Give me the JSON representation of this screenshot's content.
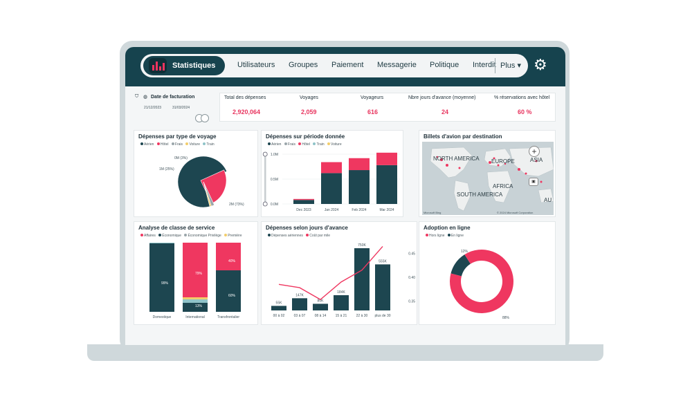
{
  "nav": {
    "active": "Statistiques",
    "items": [
      "Utilisateurs",
      "Groupes",
      "Paiement",
      "Messagerie",
      "Politique",
      "Interdit"
    ],
    "more": "Plus",
    "settings_icon": "gear-icon"
  },
  "filter": {
    "label": "Date de facturation",
    "start": "21/12/2023",
    "end": "31/03/2024"
  },
  "kpis": [
    {
      "label": "Total des dépenses",
      "value": "2,920,064"
    },
    {
      "label": "Voyages",
      "value": "2,059"
    },
    {
      "label": "Voyageurs",
      "value": "616"
    },
    {
      "label": "Nbre jours d'avance (moyenne)",
      "value": "24"
    },
    {
      "label": "% réservations avec hôtel",
      "value": "60 %"
    }
  ],
  "colors": {
    "teal": "#1d4650",
    "pink": "#ef3760",
    "grey": "#9aa6aa",
    "yellow": "#f2cd6a",
    "light": "#8fc3c8"
  },
  "pie_card": {
    "title": "Dépenses par type de voyage",
    "legend": [
      "Aérien",
      "Hôtel",
      "Frais",
      "Voiture",
      "Train"
    ],
    "labels": {
      "small": "0M (3%)",
      "pink": "1M (25%)",
      "teal": "2M (73%)"
    }
  },
  "period_card": {
    "title": "Dépenses sur période donnée",
    "legend": [
      "Aérien",
      "Frais",
      "Hôtel",
      "Train",
      "Voiture"
    ],
    "yticks": [
      "1.0M",
      "0.5M",
      "0.0M"
    ]
  },
  "map_card": {
    "title": "Billets d'avion par destination",
    "labels": [
      "NORTH AMERICA",
      "EUROPE",
      "ASIA",
      "AFRICA",
      "SOUTH AMERICA",
      "AU"
    ],
    "attribution": "© 2024 Microsoft Corporation",
    "brand": "Microsoft Bing"
  },
  "class_card": {
    "title": "Analyse de classe de service",
    "legend": [
      "Affaires",
      "Économique",
      "Économique Privilège",
      "Première"
    ],
    "pct": {
      "dom": "99%",
      "int_pink": "79%",
      "int_teal": "13%",
      "trans_pink": "40%",
      "trans_teal": "60%"
    }
  },
  "advance_card": {
    "title": "Dépenses selon jours d'avance",
    "legend": [
      "Dépenses aériennes",
      "Coût par mile"
    ],
    "yticks_right": [
      "0.45",
      "0.40",
      "0.35"
    ]
  },
  "adoption_card": {
    "title": "Adoption en ligne",
    "legend": [
      "Hors ligne",
      "En ligne"
    ],
    "labels": {
      "offline": "12%",
      "online": "88%"
    }
  },
  "chart_data": [
    {
      "type": "pie",
      "title": "Dépenses par type de voyage",
      "slices": [
        {
          "name": "Aérien",
          "value": 73,
          "label": "2M (73%)"
        },
        {
          "name": "Hôtel",
          "value": 25,
          "label": "1M (25%)"
        },
        {
          "name": "Frais",
          "value": 2,
          "label": "0M (3%)"
        },
        {
          "name": "Voiture",
          "value": 1
        }
      ]
    },
    {
      "type": "bar",
      "title": "Dépenses sur période donnée",
      "categories": [
        "Dec 2023",
        "Jan 2024",
        "Feb 2024",
        "Mar 2024"
      ],
      "series": [
        {
          "name": "Aérien",
          "values": [
            0.08,
            0.62,
            0.68,
            0.78
          ]
        },
        {
          "name": "Hôtel",
          "values": [
            0.02,
            0.22,
            0.24,
            0.25
          ]
        }
      ],
      "ylim": [
        0,
        1.0
      ]
    },
    {
      "type": "bar",
      "title": "Analyse de classe de service",
      "categories": [
        "Domestique",
        "International",
        "Transfrontalier"
      ],
      "series": [
        {
          "name": "Affaires",
          "values": [
            0,
            79,
            40
          ]
        },
        {
          "name": "Économique",
          "values": [
            99,
            13,
            60
          ]
        },
        {
          "name": "Économique Privilège",
          "values": [
            1,
            5,
            0
          ]
        },
        {
          "name": "Première",
          "values": [
            0,
            3,
            0
          ]
        }
      ]
    },
    {
      "type": "bar",
      "title": "Dépenses selon jours d'avance",
      "categories": [
        "00 à 02",
        "03 à 07",
        "08 à 14",
        "15 à 21",
        "22 à 30",
        "plus de 30"
      ],
      "series": [
        {
          "name": "Dépenses aériennes",
          "values": [
            55,
            147,
            80,
            184,
            750,
            555
          ],
          "labels": [
            "55K",
            "147K",
            "80K",
            "184K",
            "750K",
            "555K"
          ]
        },
        {
          "name": "Coût par mile",
          "values": [
            0.385,
            0.378,
            0.353,
            0.39,
            0.415,
            0.465
          ]
        }
      ],
      "y2lim": [
        0.33,
        0.47
      ]
    },
    {
      "type": "pie",
      "title": "Adoption en ligne",
      "slices": [
        {
          "name": "Hors ligne",
          "value": 12,
          "label": "12%"
        },
        {
          "name": "En ligne",
          "value": 88,
          "label": "88%"
        }
      ]
    }
  ]
}
